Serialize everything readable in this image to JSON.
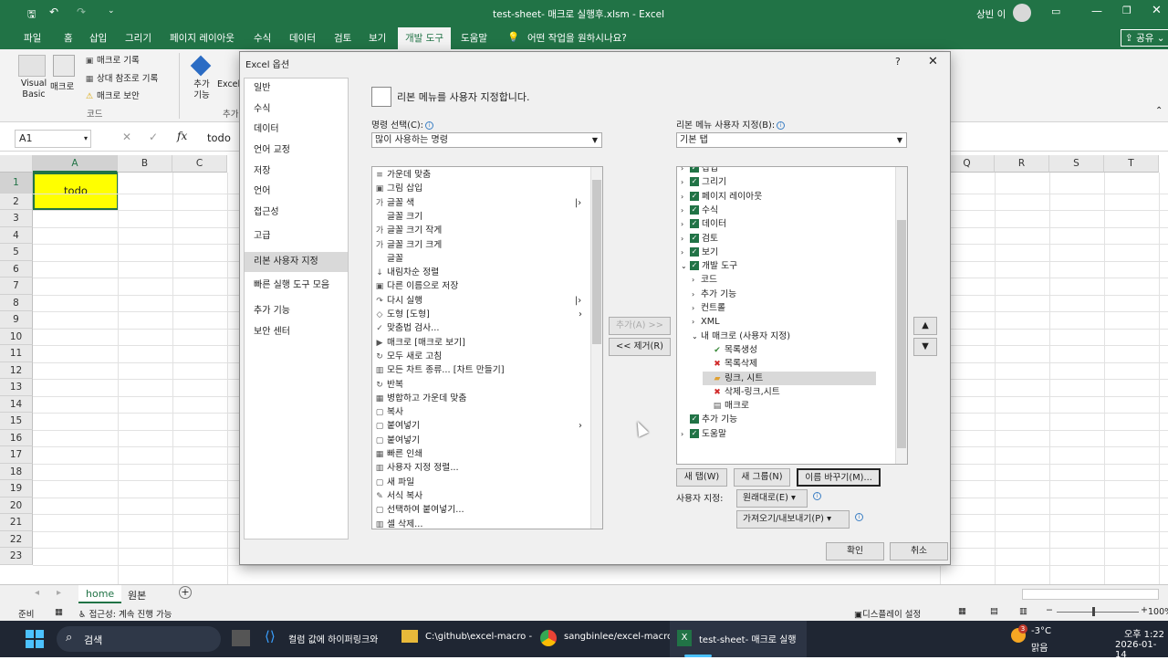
{
  "titlebar": {
    "title": "test-sheet- 매크로 실행후.xlsm  -  Excel",
    "user": "상빈 이"
  },
  "menu_tabs": [
    "파일",
    "홈",
    "삽입",
    "그리기",
    "페이지 레이아웃",
    "수식",
    "데이터",
    "검토",
    "보기",
    "개발 도구",
    "도움말"
  ],
  "menu_search": "어떤 작업을 원하시나요?",
  "share_label": "공유",
  "ribbon": {
    "visual_basic": "Visual Basic",
    "macro": "매크로",
    "record": "매크로 기록",
    "relative": "상대 참조로 기록",
    "security": "매크로 보안",
    "group_code": "코드",
    "addins": "추가 기능",
    "excel_addins": "Excel 추가",
    "group_addins_partial": "추가"
  },
  "formula_bar": {
    "name_box": "A1",
    "fx": "fx",
    "value": "todo"
  },
  "grid": {
    "columns": [
      "A",
      "B",
      "C",
      "Q",
      "R",
      "S",
      "T"
    ],
    "rows": [
      "1",
      "2",
      "3",
      "4",
      "5",
      "6",
      "7",
      "8",
      "9",
      "10",
      "11",
      "12",
      "13",
      "14",
      "15",
      "16",
      "17",
      "18",
      "19",
      "20",
      "21",
      "22",
      "23"
    ],
    "a1": "todo"
  },
  "sheets": {
    "active": "home",
    "other": "원본"
  },
  "status": {
    "ready": "준비",
    "accessibility": "접근성: 계속 진행 가능",
    "display": "디스플레이 설정",
    "zoom": "100%"
  },
  "dialog": {
    "title": "Excel 옵션",
    "help": "?",
    "close": "✕",
    "nav": [
      "일반",
      "수식",
      "데이터",
      "언어 교정",
      "저장",
      "언어",
      "접근성",
      "고급",
      "리본 사용자 지정",
      "빠른 실행 도구 모음",
      "추가 기능",
      "보안 센터"
    ],
    "heading": "리본 메뉴를 사용자 지정합니다.",
    "left_label": "명령 선택(C):",
    "left_combo": "많이 사용하는 명령",
    "commands": [
      "가운데 맞춤",
      "그림 삽입",
      "글꼴 색",
      "글꼴 크기",
      "글꼴 크기 작게",
      "글꼴 크기 크게",
      "글꼴",
      "내림차순 정렬",
      "다른 이름으로 저장",
      "다시 실행",
      "도형 [도형]",
      "맞춤법 검사...",
      "매크로 [매크로 보기]",
      "모두 새로 고침",
      "모든 차트 종류... [차트 만들기]",
      "반복",
      "병합하고 가운데 맞춤",
      "복사",
      "붙여넣기",
      "붙여넣기",
      "빠른 인쇄",
      "사용자 지정 정렬...",
      "새 파일",
      "서식 복사",
      "선택하여 붙여넣기...",
      "셀 삭제..."
    ],
    "right_label": "리본 메뉴 사용자 지정(B):",
    "right_combo": "기본 탭",
    "tabs_tree": [
      "삽입",
      "그리기",
      "페이지 레이아웃",
      "수식",
      "데이터",
      "검토",
      "보기",
      "개발 도구",
      "코드",
      "추가 기능",
      "컨트롤",
      "XML",
      "내 매크로 (사용자 지정)",
      "목록생성",
      "목록삭제",
      "링크, 시트",
      "삭제-링크,시트",
      "매크로",
      "추가 기능",
      "도움말"
    ],
    "add_btn": "추가(A) >>",
    "remove_btn": "<< 제거(R)",
    "new_tab": "새 탭(W)",
    "new_group": "새 그룹(N)",
    "rename": "이름 바꾸기(M)...",
    "customize_label": "사용자 지정:",
    "reset": "원래대로(E)",
    "import_export": "가져오기/내보내기(P)",
    "ok": "확인",
    "cancel": "취소"
  },
  "taskbar": {
    "search": "검색",
    "items": [
      "컬럼 값에 하이퍼링크와",
      "C:\\github\\excel-macro -",
      "sangbinlee/excel-macrc",
      "test-sheet- 매크로 실행"
    ],
    "weather_temp": "-3°C",
    "weather_desc": "맑음",
    "weather_badge": "3",
    "time": "오후 1:22",
    "date": "2026-01-14"
  },
  "colors": {
    "excel_green": "#217346",
    "highlight_yellow": "#ffff00",
    "taskbar": "#1f2633"
  }
}
